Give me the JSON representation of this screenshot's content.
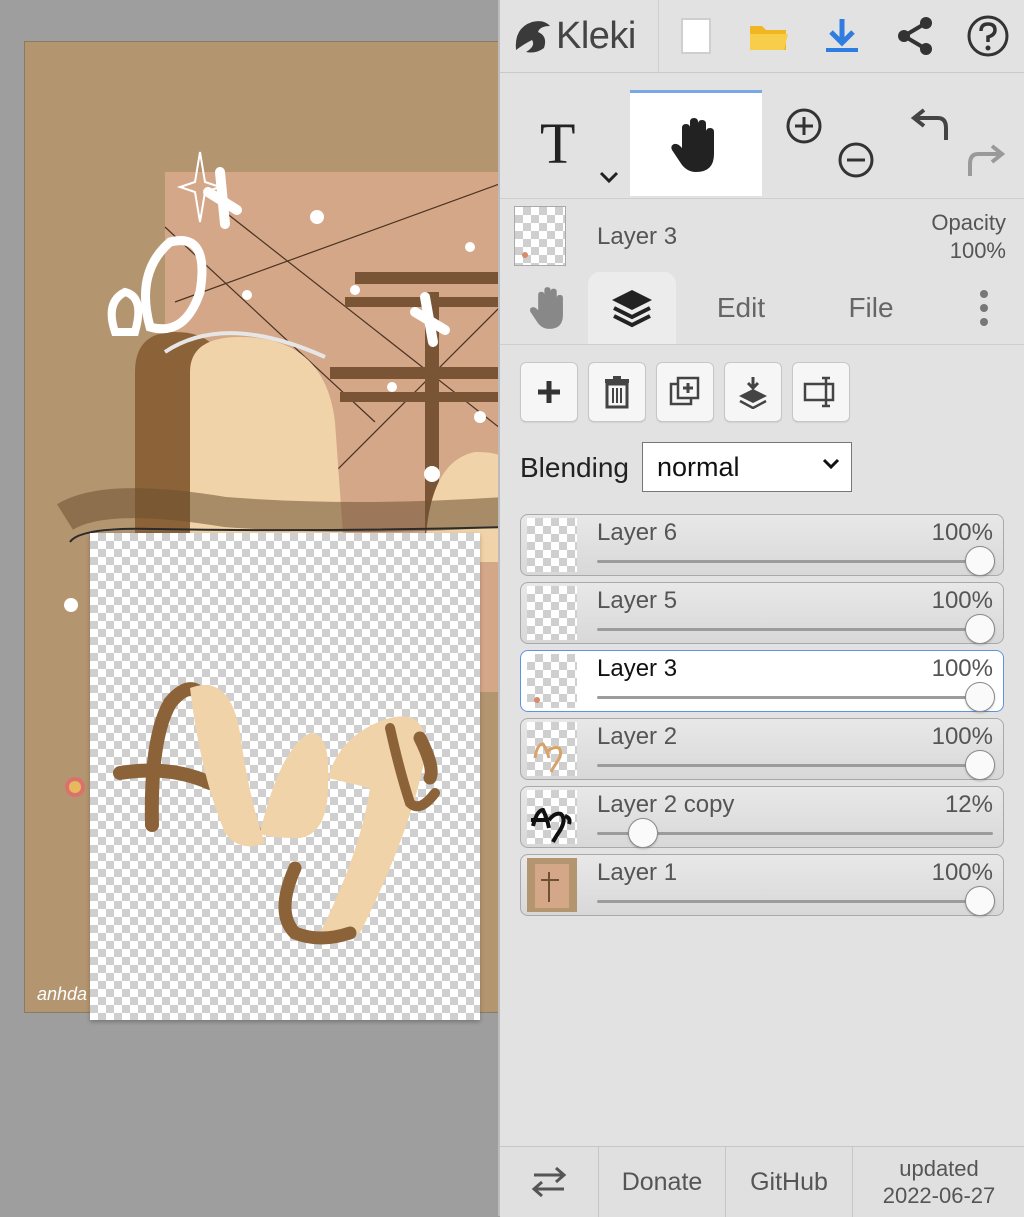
{
  "app": {
    "name": "Kleki"
  },
  "current_layer": {
    "name": "Layer 3",
    "opacity_label": "Opacity",
    "opacity_value": "100%"
  },
  "tabs": [
    {
      "label": "Edit"
    },
    {
      "label": "File"
    }
  ],
  "blending": {
    "label": "Blending",
    "value": "normal"
  },
  "layers": [
    {
      "name": "Layer 6",
      "opacity": "100%",
      "opacity_value": 1.0,
      "active": false
    },
    {
      "name": "Layer 5",
      "opacity": "100%",
      "opacity_value": 1.0,
      "active": false
    },
    {
      "name": "Layer 3",
      "opacity": "100%",
      "opacity_value": 1.0,
      "active": true
    },
    {
      "name": "Layer 2",
      "opacity": "100%",
      "opacity_value": 1.0,
      "active": false
    },
    {
      "name": "Layer 2 copy",
      "opacity": "12%",
      "opacity_value": 0.12,
      "active": false
    },
    {
      "name": "Layer 1",
      "opacity": "100%",
      "opacity_value": 1.0,
      "active": false
    }
  ],
  "footer": {
    "donate": "Donate",
    "github": "GitHub",
    "updated_label": "updated",
    "updated_date": "2022-06-27"
  },
  "icons": {
    "new": "new-file-icon",
    "open": "folder-icon",
    "save": "download-icon",
    "share": "share-icon",
    "help": "help-icon",
    "text": "text-tool-icon",
    "hand": "hand-tool-icon",
    "zoom_in": "zoom-in-icon",
    "zoom_out": "zoom-out-icon",
    "undo": "undo-icon",
    "redo": "redo-icon",
    "layers": "layers-icon",
    "menu": "more-vertical-icon",
    "swap": "swap-icon"
  },
  "colors": {
    "accent": "#2f7de1",
    "canvas_bg": "#b0936b",
    "sidebar_bg": "#e2e2e2",
    "brown": "#8c6239",
    "cream": "#f0d3a8"
  }
}
